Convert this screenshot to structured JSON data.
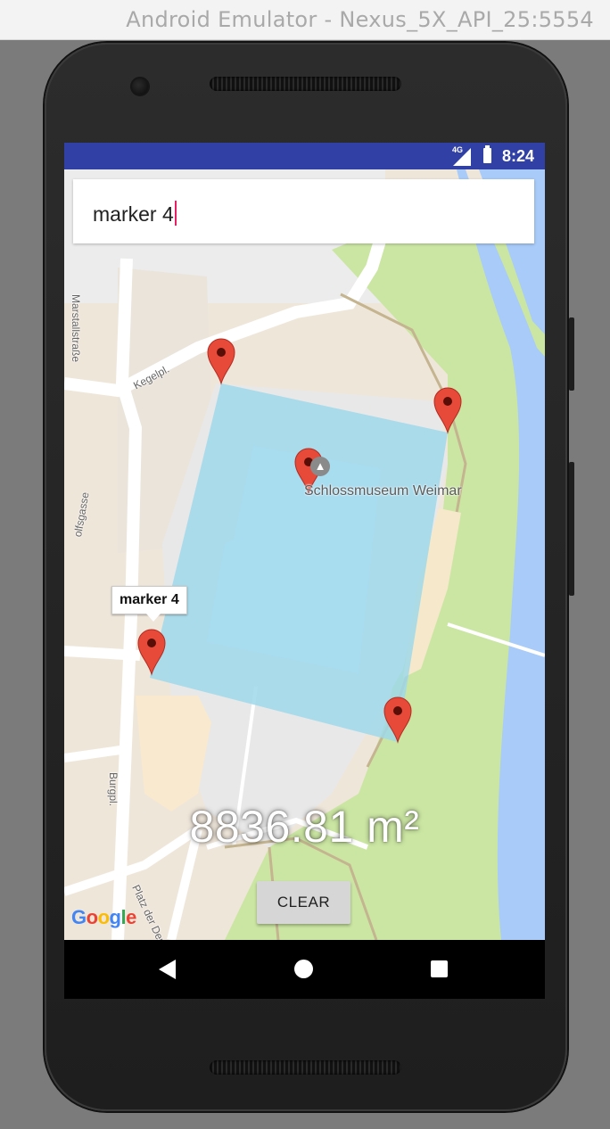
{
  "window": {
    "title": "Android Emulator - Nexus_5X_API_25:5554"
  },
  "status_bar": {
    "network": "4G",
    "time": "8:24",
    "color": "#3140a4"
  },
  "search": {
    "value": "marker 4"
  },
  "map": {
    "poi": {
      "name": "Schlossmuseum Weimar"
    },
    "streets": [
      "Marstallstraße",
      "Kegelpl.",
      "Burgpl.",
      "Platz der Demo",
      "olfsgasse"
    ],
    "markers": [
      "marker 1",
      "marker 2",
      "marker 3",
      "marker 4",
      "marker 5"
    ],
    "info_window": {
      "title": "marker 4"
    },
    "polygon_color": "#9fd8ea",
    "attribution": "Google"
  },
  "area": {
    "value": "8836.81 m²"
  },
  "clear_button": {
    "label": "CLEAR"
  },
  "nav": {
    "back": "back-icon",
    "home": "home-icon",
    "recents": "recents-icon"
  }
}
